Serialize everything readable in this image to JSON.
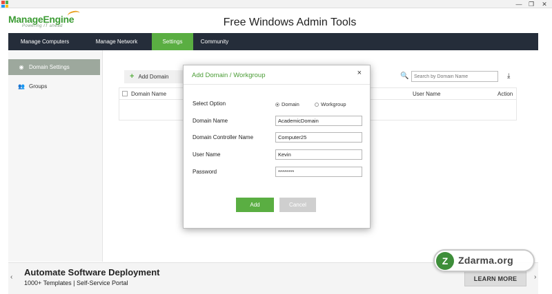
{
  "window": {
    "min": "—",
    "max": "❐",
    "close": "✕"
  },
  "header": {
    "logo_brand": "ManageEngine",
    "logo_tagline": "Powering IT ahead",
    "app_title": "Free Windows Admin Tools"
  },
  "nav": {
    "items": [
      {
        "label": "Manage Computers"
      },
      {
        "label": "Manage Network"
      },
      {
        "label": "Settings",
        "active": true
      },
      {
        "label": "Community"
      }
    ]
  },
  "sidebar": {
    "items": [
      {
        "label": "Domain Settings",
        "icon": "globe-icon",
        "active": true
      },
      {
        "label": "Groups",
        "icon": "users-icon"
      }
    ]
  },
  "main": {
    "add_domain_label": "Add Domain",
    "search_placeholder": "Search by Domain Name",
    "table": {
      "columns": [
        "Domain Name",
        "User Name",
        "Action"
      ]
    }
  },
  "modal": {
    "title": "Add Domain / Workgroup",
    "close": "×",
    "select_option_label": "Select Option",
    "options": [
      {
        "label": "Domain",
        "selected": true
      },
      {
        "label": "Workgroup",
        "selected": false
      }
    ],
    "fields": [
      {
        "label": "Domain Name",
        "value": "AcademicDomain"
      },
      {
        "label": "Domain Controller Name",
        "value": "Computer25"
      },
      {
        "label": "User Name",
        "value": "Kevin"
      },
      {
        "label": "Password",
        "value": "********"
      }
    ],
    "add_label": "Add",
    "cancel_label": "Cancel"
  },
  "banner": {
    "title": "Automate Software Deployment",
    "subtitle": "1000+ Templates | Self-Service Portal",
    "learn_more": "LEARN MORE",
    "prev": "‹",
    "next": "›"
  },
  "watermark": {
    "logo": "Z",
    "text": "Zdarma.org"
  },
  "colors": {
    "accent": "#5aae42",
    "nav_bg": "#252d3a",
    "modal_title": "#4a9c35"
  }
}
